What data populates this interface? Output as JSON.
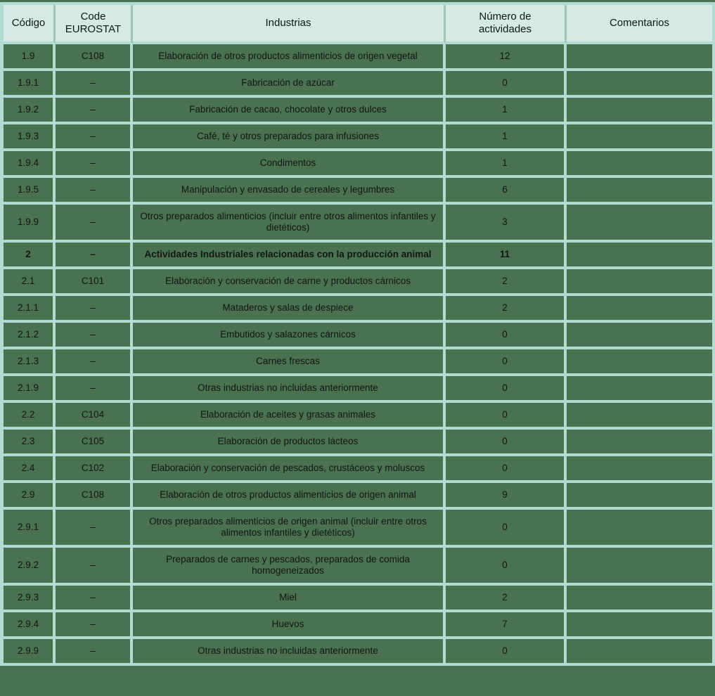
{
  "colors": {
    "page_background": "#4a7150",
    "cell_background": "#4a7150",
    "header_background": "#d5eae3",
    "grid_border": "#b2dcd1",
    "header_divider": "#9fc7bb",
    "text": "#101714"
  },
  "table": {
    "headers": [
      {
        "key": "codigo",
        "label": "Código"
      },
      {
        "key": "code",
        "label": "Code\nEUROSTAT"
      },
      {
        "key": "industria",
        "label": "Industrias"
      },
      {
        "key": "num",
        "label": "Número de\nactividades"
      },
      {
        "key": "comentario",
        "label": "Comentarios"
      }
    ],
    "rows": [
      {
        "codigo": "1.9",
        "code": "C108",
        "industria": "Elaboración de otros productos alimenticios de origen vegetal",
        "num": "12",
        "comentario": "",
        "bold": false
      },
      {
        "codigo": "1.9.1",
        "code": "–",
        "industria": "Fabricación de azúcar",
        "num": "0",
        "comentario": "",
        "bold": false
      },
      {
        "codigo": "1.9.2",
        "code": "–",
        "industria": "Fabricación de cacao, chocolate y otros dulces",
        "num": "1",
        "comentario": "",
        "bold": false
      },
      {
        "codigo": "1.9.3",
        "code": "–",
        "industria": "Café, té y otros preparados para infusiones",
        "num": "1",
        "comentario": "",
        "bold": false
      },
      {
        "codigo": "1.9.4",
        "code": "–",
        "industria": "Condimentos",
        "num": "1",
        "comentario": "",
        "bold": false
      },
      {
        "codigo": "1.9.5",
        "code": "–",
        "industria": "Manipulación y envasado de cereales y legumbres",
        "num": "6",
        "comentario": "",
        "bold": false
      },
      {
        "codigo": "1.9.9",
        "code": "–",
        "industria": "Otros preparados alimenticios (incluir entre otros alimentos infantiles y dietéticos)",
        "num": "3",
        "comentario": "",
        "bold": false
      },
      {
        "codigo": "2",
        "code": "–",
        "industria": "Actividades Industriales relacionadas con la producción animal",
        "num": "11",
        "comentario": "",
        "bold": true
      },
      {
        "codigo": "2.1",
        "code": "C101",
        "industria": "Elaboración y conservación de carne y productos cárnicos",
        "num": "2",
        "comentario": "",
        "bold": false
      },
      {
        "codigo": "2.1.1",
        "code": "–",
        "industria": "Mataderos y salas de despiece",
        "num": "2",
        "comentario": "",
        "bold": false
      },
      {
        "codigo": "2.1.2",
        "code": "–",
        "industria": "Embutidos y salazones cárnicos",
        "num": "0",
        "comentario": "",
        "bold": false
      },
      {
        "codigo": "2.1.3",
        "code": "–",
        "industria": "Carnes frescas",
        "num": "0",
        "comentario": "",
        "bold": false
      },
      {
        "codigo": "2.1.9",
        "code": "–",
        "industria": "Otras industrias no incluidas anteriormente",
        "num": "0",
        "comentario": "",
        "bold": false
      },
      {
        "codigo": "2.2",
        "code": "C104",
        "industria": "Elaboración de aceites y grasas animales",
        "num": "0",
        "comentario": "",
        "bold": false
      },
      {
        "codigo": "2.3",
        "code": "C105",
        "industria": "Elaboración de productos lácteos",
        "num": "0",
        "comentario": "",
        "bold": false
      },
      {
        "codigo": "2.4",
        "code": "C102",
        "industria": "Elaboración y conservación de pescados, crustáceos y moluscos",
        "num": "0",
        "comentario": "",
        "bold": false
      },
      {
        "codigo": "2.9",
        "code": "C108",
        "industria": "Elaboración de otros productos alimenticios de origen animal",
        "num": "9",
        "comentario": "",
        "bold": false
      },
      {
        "codigo": "2.9.1",
        "code": "–",
        "industria": "Otros preparados alimenticios de origen animal (incluir entre otros alimentos infantiles y dietéticos)",
        "num": "0",
        "comentario": "",
        "bold": false
      },
      {
        "codigo": "2.9.2",
        "code": "–",
        "industria": "Preparados de carnes y pescados, preparados de comida homogeneizados",
        "num": "0",
        "comentario": "",
        "bold": false
      },
      {
        "codigo": "2.9.3",
        "code": "–",
        "industria": "Miel",
        "num": "2",
        "comentario": "",
        "bold": false
      },
      {
        "codigo": "2.9.4",
        "code": "–",
        "industria": "Huevos",
        "num": "7",
        "comentario": "",
        "bold": false
      },
      {
        "codigo": "2.9.9",
        "code": "–",
        "industria": "Otras industrias no incluidas anteriormente",
        "num": "0",
        "comentario": "",
        "bold": false
      }
    ]
  }
}
